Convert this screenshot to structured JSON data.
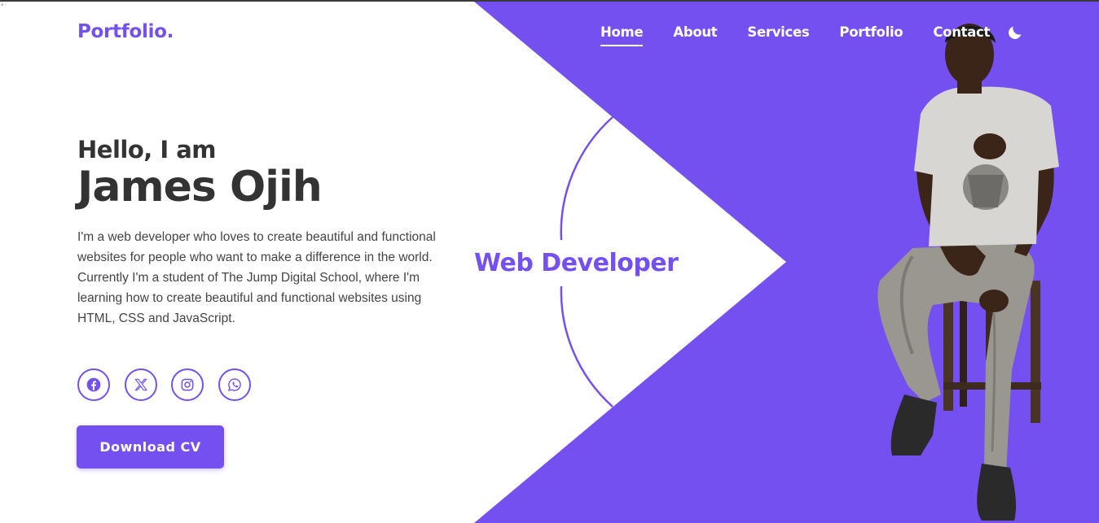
{
  "brand": {
    "logo": "Portfolio."
  },
  "nav": {
    "items": [
      {
        "label": "Home",
        "active": true
      },
      {
        "label": "About",
        "active": false
      },
      {
        "label": "Services",
        "active": false
      },
      {
        "label": "Portfolio",
        "active": false
      },
      {
        "label": "Contact",
        "active": false
      }
    ],
    "theme_toggle_icon": "moon-icon"
  },
  "hero": {
    "greeting": "Hello, I am",
    "name": "James Ojih",
    "description": [
      "I'm a web developer who loves to create beautiful and functional websites for people who want to make a difference in the world.",
      "Currently I'm a student of The Jump Digital School, where I'm learning how to create beautiful and functional websites using HTML, CSS and JavaScript."
    ],
    "role": "Web Developer",
    "cta_label": "Download CV",
    "socials": [
      "facebook-icon",
      "x-twitter-icon",
      "instagram-icon",
      "whatsapp-icon"
    ]
  },
  "colors": {
    "accent": "#7550f0",
    "text_dark": "#333333",
    "background": "#ffffff"
  }
}
